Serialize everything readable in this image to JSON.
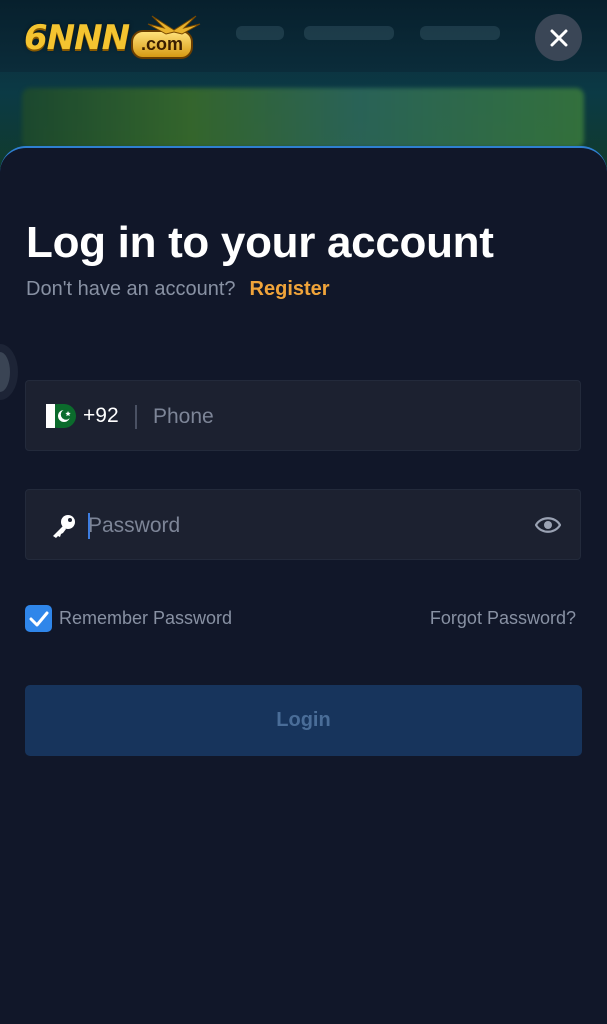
{
  "logo": {
    "brand": "6NNN",
    "suffix": ".com"
  },
  "close": {
    "icon": "close-icon"
  },
  "auth": {
    "title": "Log in to your account",
    "no_account_text": "Don't have an account?",
    "register_label": "Register"
  },
  "phone": {
    "country_flag": "pakistan-flag-icon",
    "country_code": "+92",
    "placeholder": "Phone",
    "value": ""
  },
  "password": {
    "icon": "key-icon",
    "placeholder": "Password",
    "value": "",
    "toggle_icon": "eye-icon"
  },
  "remember": {
    "label": "Remember Password",
    "checked": true
  },
  "forgot_label": "Forgot Password?",
  "login_label": "Login",
  "colors": {
    "accent": "#2f86ea",
    "register": "#f0a43a",
    "sheet_bg": "#111729",
    "field_bg": "#1c2130",
    "button_disabled": "#17345c"
  }
}
